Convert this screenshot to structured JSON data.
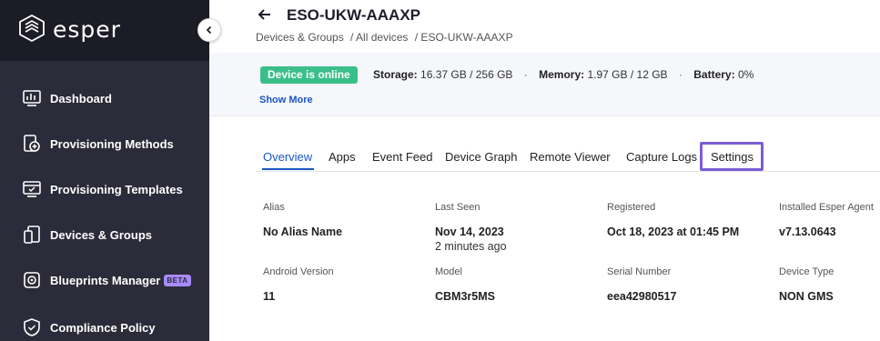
{
  "brand": {
    "name": "esper"
  },
  "sidebar": {
    "items": [
      {
        "label": "Dashboard",
        "icon": "dashboard-icon"
      },
      {
        "label": "Provisioning Methods",
        "icon": "provisioning-methods-icon"
      },
      {
        "label": "Provisioning Templates",
        "icon": "provisioning-templates-icon"
      },
      {
        "label": "Devices & Groups",
        "icon": "devices-icon"
      },
      {
        "label": "Blueprints Manager",
        "icon": "blueprints-icon",
        "badge": "BETA"
      },
      {
        "label": "Compliance Policy",
        "icon": "shield-check-icon"
      }
    ]
  },
  "header": {
    "title": "ESO-UKW-AAAXP",
    "breadcrumb": [
      "Devices & Groups",
      "/ All devices",
      "/ ESO-UKW-AAAXP"
    ]
  },
  "status": {
    "badge": "Device is online",
    "storage_label": "Storage:",
    "storage_value": "16.37 GB / 256 GB",
    "memory_label": "Memory:",
    "memory_value": "1.97 GB / 12 GB",
    "battery_label": "Battery:",
    "battery_value": "0%",
    "separator": "·",
    "show_more": "Show More"
  },
  "tabs": [
    "Overview",
    "Apps",
    "Event Feed",
    "Device Graph",
    "Remote Viewer",
    "Capture Logs",
    "Settings"
  ],
  "active_tab": "Overview",
  "highlighted_tab": "Settings",
  "info": {
    "alias": {
      "label": "Alias",
      "value": "No Alias Name"
    },
    "last_seen": {
      "label": "Last Seen",
      "value": "Nov 14, 2023",
      "sub": "2 minutes ago"
    },
    "registered": {
      "label": "Registered",
      "value": "Oct 18, 2023 at 01:45 PM"
    },
    "agent": {
      "label": "Installed Esper Agent",
      "value": "v7.13.0643"
    },
    "android": {
      "label": "Android Version",
      "value": "11"
    },
    "model": {
      "label": "Model",
      "value": "CBM3r5MS"
    },
    "serial": {
      "label": "Serial Number",
      "value": "eea42980517"
    },
    "device_type": {
      "label": "Device Type",
      "value": "NON GMS"
    }
  },
  "colors": {
    "sidebar_bg": "#2b2b3a",
    "accent": "#1a56c4",
    "online": "#3bbf8a",
    "highlight": "#7c5cd6"
  }
}
